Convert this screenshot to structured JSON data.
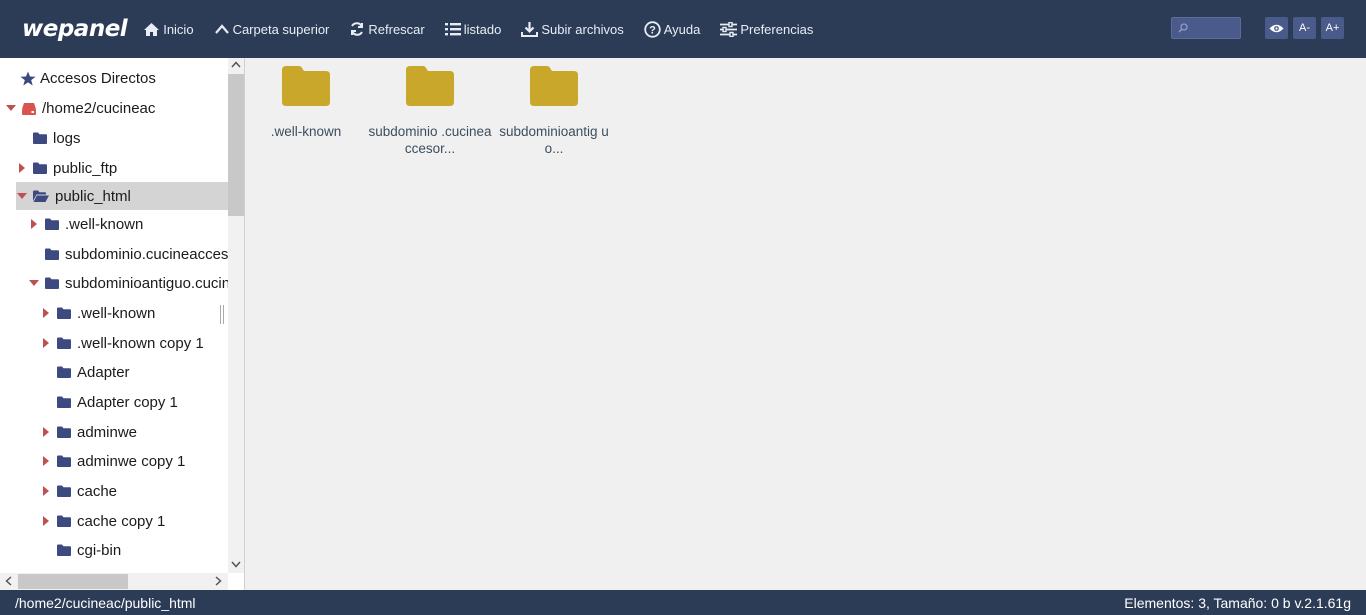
{
  "app": {
    "logo": "wepanel"
  },
  "toolbar": {
    "items": [
      {
        "label": "Inicio",
        "icon": "home-icon"
      },
      {
        "label": "Carpeta superior",
        "icon": "chevron-up-icon"
      },
      {
        "label": "Refrescar",
        "icon": "refresh-icon"
      },
      {
        "label": "listado",
        "icon": "list-icon"
      },
      {
        "label": "Subir archivos",
        "icon": "upload-icon"
      },
      {
        "label": "Ayuda",
        "icon": "help-icon"
      },
      {
        "label": "Preferencias",
        "icon": "sliders-icon"
      }
    ],
    "search_placeholder": "",
    "font_decrease": "A-",
    "font_increase": "A+"
  },
  "tree": {
    "shortcuts_label": "Accesos Directos",
    "items": [
      {
        "label": "/home2/cucineac",
        "caret": "down",
        "icon": "drive"
      },
      {
        "label": "logs",
        "caret": "none",
        "icon": "folder"
      },
      {
        "label": "public_ftp",
        "caret": "right",
        "icon": "folder"
      },
      {
        "label": "public_html",
        "caret": "down",
        "icon": "folder-open",
        "selected": true
      },
      {
        "label": ".well-known",
        "caret": "right",
        "icon": "folder"
      },
      {
        "label": "subdominio.cucineaccesorios",
        "caret": "none",
        "icon": "folder"
      },
      {
        "label": "subdominioantiguo.cucineaccesorios",
        "caret": "down",
        "icon": "folder"
      },
      {
        "label": ".well-known",
        "caret": "right",
        "icon": "folder"
      },
      {
        "label": ".well-known copy 1",
        "caret": "right",
        "icon": "folder"
      },
      {
        "label": "Adapter",
        "caret": "none",
        "icon": "folder"
      },
      {
        "label": "Adapter copy 1",
        "caret": "none",
        "icon": "folder"
      },
      {
        "label": "adminwe",
        "caret": "right",
        "icon": "folder"
      },
      {
        "label": "adminwe copy 1",
        "caret": "right",
        "icon": "folder"
      },
      {
        "label": "cache",
        "caret": "right",
        "icon": "folder"
      },
      {
        "label": "cache copy 1",
        "caret": "right",
        "icon": "folder"
      },
      {
        "label": "cgi-bin",
        "caret": "none",
        "icon": "folder"
      }
    ]
  },
  "files": [
    {
      "name": ".well-known"
    },
    {
      "name": "subdominio .cucineaccesor..."
    },
    {
      "name": "subdominioantig uo..."
    }
  ],
  "status": {
    "path": "/home2/cucineac/public_html",
    "summary": "Elementos: 3, Tamaño: 0 b v.2.1.61g"
  },
  "colors": {
    "topbar": "#2c3c57",
    "folder_tree": "#3d4a80",
    "folder_big": "#c9a72a",
    "caret": "#c0504d"
  }
}
